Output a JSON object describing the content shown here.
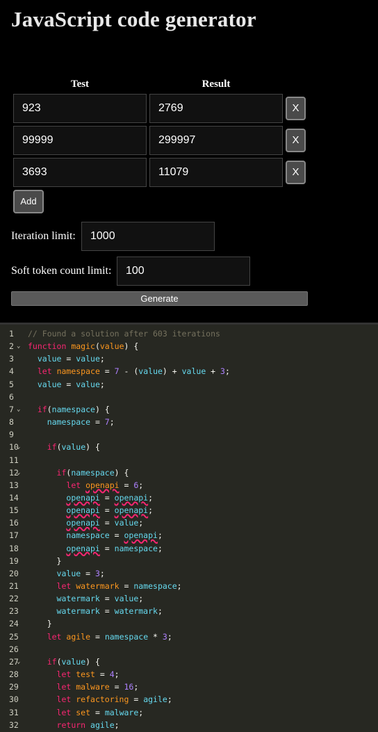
{
  "title": "JavaScript code generator",
  "tests": {
    "col_test": "Test",
    "col_result": "Result",
    "rows": [
      {
        "test": "923",
        "result": "2769",
        "remove": "X"
      },
      {
        "test": "99999",
        "result": "299997",
        "remove": "X"
      },
      {
        "test": "3693",
        "result": "11079",
        "remove": "X"
      }
    ],
    "add_label": "Add"
  },
  "iteration_limit": {
    "label": "Iteration limit:",
    "value": "1000"
  },
  "soft_token_limit": {
    "label": "Soft token count limit:",
    "value": "100"
  },
  "generate_label": "Generate",
  "editor": {
    "lines": [
      {
        "n": "1",
        "fold": false,
        "tokens": [
          [
            "cmt",
            "// Found a solution after 603 iterations"
          ]
        ]
      },
      {
        "n": "2",
        "fold": true,
        "tokens": [
          [
            "kw",
            "function "
          ],
          [
            "fn",
            "magic"
          ],
          [
            "p",
            "("
          ],
          [
            "dec",
            "value"
          ],
          [
            "p",
            ") {"
          ]
        ]
      },
      {
        "n": "3",
        "fold": false,
        "tokens": [
          [
            "p",
            "  "
          ],
          [
            "id",
            "value"
          ],
          [
            "p",
            " = "
          ],
          [
            "id",
            "value"
          ],
          [
            "p",
            ";"
          ]
        ]
      },
      {
        "n": "4",
        "fold": false,
        "tokens": [
          [
            "p",
            "  "
          ],
          [
            "kw",
            "let "
          ],
          [
            "dec",
            "namespace"
          ],
          [
            "p",
            " = "
          ],
          [
            "num",
            "7"
          ],
          [
            "p",
            " - ("
          ],
          [
            "id",
            "value"
          ],
          [
            "p",
            ") + "
          ],
          [
            "id",
            "value"
          ],
          [
            "p",
            " + "
          ],
          [
            "num",
            "3"
          ],
          [
            "p",
            ";"
          ]
        ]
      },
      {
        "n": "5",
        "fold": false,
        "tokens": [
          [
            "p",
            "  "
          ],
          [
            "id",
            "value"
          ],
          [
            "p",
            " = "
          ],
          [
            "id",
            "value"
          ],
          [
            "p",
            ";"
          ]
        ]
      },
      {
        "n": "6",
        "fold": false,
        "tokens": []
      },
      {
        "n": "7",
        "fold": true,
        "tokens": [
          [
            "p",
            "  "
          ],
          [
            "kw",
            "if"
          ],
          [
            "p",
            "("
          ],
          [
            "id",
            "namespace"
          ],
          [
            "p",
            ") {"
          ]
        ]
      },
      {
        "n": "8",
        "fold": false,
        "tokens": [
          [
            "p",
            "    "
          ],
          [
            "id",
            "namespace"
          ],
          [
            "p",
            " = "
          ],
          [
            "num",
            "7"
          ],
          [
            "p",
            ";"
          ]
        ]
      },
      {
        "n": "9",
        "fold": false,
        "tokens": []
      },
      {
        "n": "10",
        "fold": true,
        "tokens": [
          [
            "p",
            "    "
          ],
          [
            "kw",
            "if"
          ],
          [
            "p",
            "("
          ],
          [
            "id",
            "value"
          ],
          [
            "p",
            ") {"
          ]
        ]
      },
      {
        "n": "11",
        "fold": false,
        "tokens": []
      },
      {
        "n": "12",
        "fold": true,
        "tokens": [
          [
            "p",
            "      "
          ],
          [
            "kw",
            "if"
          ],
          [
            "p",
            "("
          ],
          [
            "id",
            "namespace"
          ],
          [
            "p",
            ") {"
          ]
        ]
      },
      {
        "n": "13",
        "fold": false,
        "tokens": [
          [
            "p",
            "        "
          ],
          [
            "kw",
            "let "
          ],
          [
            "dec warn",
            "openapi"
          ],
          [
            "p",
            " = "
          ],
          [
            "num",
            "6"
          ],
          [
            "p",
            ";"
          ]
        ]
      },
      {
        "n": "14",
        "fold": false,
        "tokens": [
          [
            "p",
            "        "
          ],
          [
            "id warn",
            "openapi"
          ],
          [
            "p",
            " = "
          ],
          [
            "id warn",
            "openapi"
          ],
          [
            "p",
            ";"
          ]
        ]
      },
      {
        "n": "15",
        "fold": false,
        "tokens": [
          [
            "p",
            "        "
          ],
          [
            "id warn",
            "openapi"
          ],
          [
            "p",
            " = "
          ],
          [
            "id warn",
            "openapi"
          ],
          [
            "p",
            ";"
          ]
        ]
      },
      {
        "n": "16",
        "fold": false,
        "tokens": [
          [
            "p",
            "        "
          ],
          [
            "id warn",
            "openapi"
          ],
          [
            "p",
            " = "
          ],
          [
            "id",
            "value"
          ],
          [
            "p",
            ";"
          ]
        ]
      },
      {
        "n": "17",
        "fold": false,
        "tokens": [
          [
            "p",
            "        "
          ],
          [
            "id",
            "namespace"
          ],
          [
            "p",
            " = "
          ],
          [
            "id warn",
            "openapi"
          ],
          [
            "p",
            ";"
          ]
        ]
      },
      {
        "n": "18",
        "fold": false,
        "tokens": [
          [
            "p",
            "        "
          ],
          [
            "id warn",
            "openapi"
          ],
          [
            "p",
            " = "
          ],
          [
            "id",
            "namespace"
          ],
          [
            "p",
            ";"
          ]
        ]
      },
      {
        "n": "19",
        "fold": false,
        "tokens": [
          [
            "p",
            "      }"
          ]
        ]
      },
      {
        "n": "20",
        "fold": false,
        "tokens": [
          [
            "p",
            "      "
          ],
          [
            "id",
            "value"
          ],
          [
            "p",
            " = "
          ],
          [
            "num",
            "3"
          ],
          [
            "p",
            ";"
          ]
        ]
      },
      {
        "n": "21",
        "fold": false,
        "tokens": [
          [
            "p",
            "      "
          ],
          [
            "kw",
            "let "
          ],
          [
            "dec",
            "watermark"
          ],
          [
            "p",
            " = "
          ],
          [
            "id",
            "namespace"
          ],
          [
            "p",
            ";"
          ]
        ]
      },
      {
        "n": "22",
        "fold": false,
        "tokens": [
          [
            "p",
            "      "
          ],
          [
            "id",
            "watermark"
          ],
          [
            "p",
            " = "
          ],
          [
            "id",
            "value"
          ],
          [
            "p",
            ";"
          ]
        ]
      },
      {
        "n": "23",
        "fold": false,
        "tokens": [
          [
            "p",
            "      "
          ],
          [
            "id",
            "watermark"
          ],
          [
            "p",
            " = "
          ],
          [
            "id",
            "watermark"
          ],
          [
            "p",
            ";"
          ]
        ]
      },
      {
        "n": "24",
        "fold": false,
        "tokens": [
          [
            "p",
            "    }"
          ]
        ]
      },
      {
        "n": "25",
        "fold": false,
        "tokens": [
          [
            "p",
            "    "
          ],
          [
            "kw",
            "let "
          ],
          [
            "dec",
            "agile"
          ],
          [
            "p",
            " = "
          ],
          [
            "id",
            "namespace"
          ],
          [
            "p",
            " * "
          ],
          [
            "num",
            "3"
          ],
          [
            "p",
            ";"
          ]
        ]
      },
      {
        "n": "26",
        "fold": false,
        "tokens": []
      },
      {
        "n": "27",
        "fold": true,
        "tokens": [
          [
            "p",
            "    "
          ],
          [
            "kw",
            "if"
          ],
          [
            "p",
            "("
          ],
          [
            "id",
            "value"
          ],
          [
            "p",
            ") {"
          ]
        ]
      },
      {
        "n": "28",
        "fold": false,
        "tokens": [
          [
            "p",
            "      "
          ],
          [
            "kw",
            "let "
          ],
          [
            "dec",
            "test"
          ],
          [
            "p",
            " = "
          ],
          [
            "num",
            "4"
          ],
          [
            "p",
            ";"
          ]
        ]
      },
      {
        "n": "29",
        "fold": false,
        "tokens": [
          [
            "p",
            "      "
          ],
          [
            "kw",
            "let "
          ],
          [
            "dec",
            "malware"
          ],
          [
            "p",
            " = "
          ],
          [
            "num",
            "16"
          ],
          [
            "p",
            ";"
          ]
        ]
      },
      {
        "n": "30",
        "fold": false,
        "tokens": [
          [
            "p",
            "      "
          ],
          [
            "kw",
            "let "
          ],
          [
            "dec",
            "refactoring"
          ],
          [
            "p",
            " = "
          ],
          [
            "id",
            "agile"
          ],
          [
            "p",
            ";"
          ]
        ]
      },
      {
        "n": "31",
        "fold": false,
        "tokens": [
          [
            "p",
            "      "
          ],
          [
            "kw",
            "let "
          ],
          [
            "dec",
            "set"
          ],
          [
            "p",
            " = "
          ],
          [
            "id",
            "malware"
          ],
          [
            "p",
            ";"
          ]
        ]
      },
      {
        "n": "32",
        "fold": false,
        "tokens": [
          [
            "p",
            "      "
          ],
          [
            "kw",
            "return "
          ],
          [
            "id",
            "agile"
          ],
          [
            "p",
            ";"
          ]
        ]
      }
    ]
  }
}
